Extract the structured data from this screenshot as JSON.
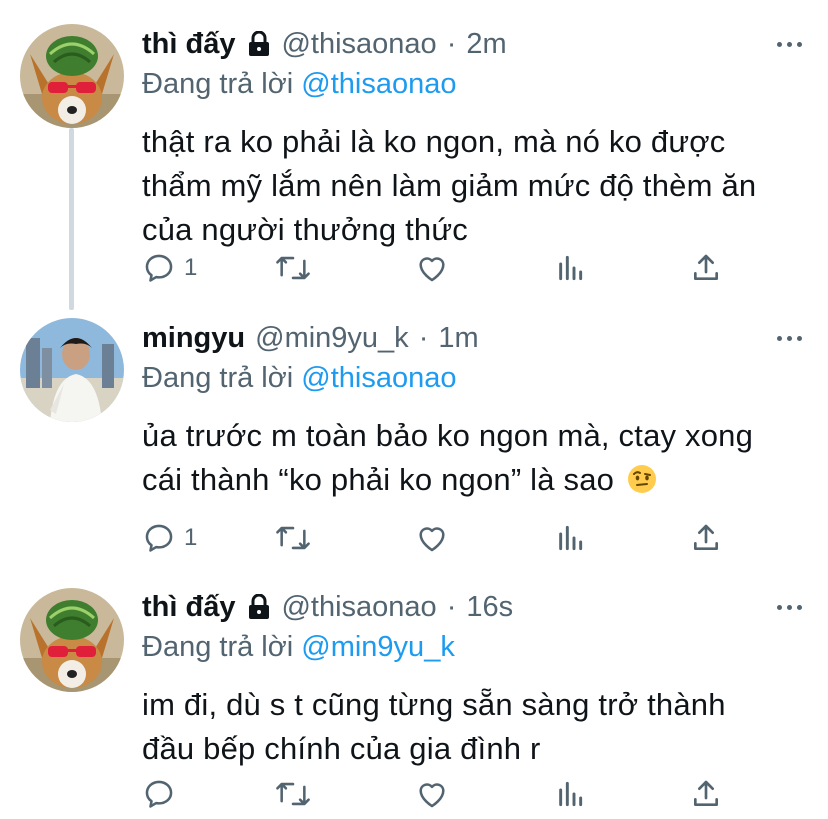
{
  "tweets": [
    {
      "name": "thì đấy",
      "locked": true,
      "handle": "@thisaonao",
      "time": "2m",
      "replying_prefix": "Đang trả lời",
      "replying_to": "@thisaonao",
      "lines": [
        "thật ra ko phải là ko ngon, mà nó ko được",
        "thẩm mỹ lắm nên làm giảm mức độ thèm ăn",
        "của người thưởng thức"
      ],
      "reply_count": "1",
      "avatar": "corgi-watermelon-avatar"
    },
    {
      "name": "mingyu",
      "locked": false,
      "handle": "@min9yu_k",
      "time": "1m",
      "replying_prefix": "Đang trả lời",
      "replying_to": "@thisaonao",
      "lines": [
        "ủa trước m toàn bảo ko ngon mà, ctay xong",
        "cái thành “ko phải ko ngon” là sao"
      ],
      "reply_count": "1",
      "avatar": "man-photo-avatar",
      "emoji": "raised-eyebrow-emoji"
    },
    {
      "name": "thì đấy",
      "locked": true,
      "handle": "@thisaonao",
      "time": "16s",
      "replying_prefix": "Đang trả lời",
      "replying_to": "@min9yu_k",
      "lines": [
        "im đi, dù s t cũng từng sẵn sàng trở thành",
        "đầu bếp chính của gia đình r"
      ],
      "reply_count": "",
      "avatar": "corgi-watermelon-avatar"
    }
  ],
  "colors": {
    "text": "#0f1419",
    "secondary": "#536471",
    "link": "#1d9bf0",
    "thread_line": "#cfd9de"
  },
  "icons": [
    "reply-icon",
    "retweet-icon",
    "like-icon",
    "analytics-icon",
    "share-icon",
    "more-icon",
    "lock-icon"
  ]
}
